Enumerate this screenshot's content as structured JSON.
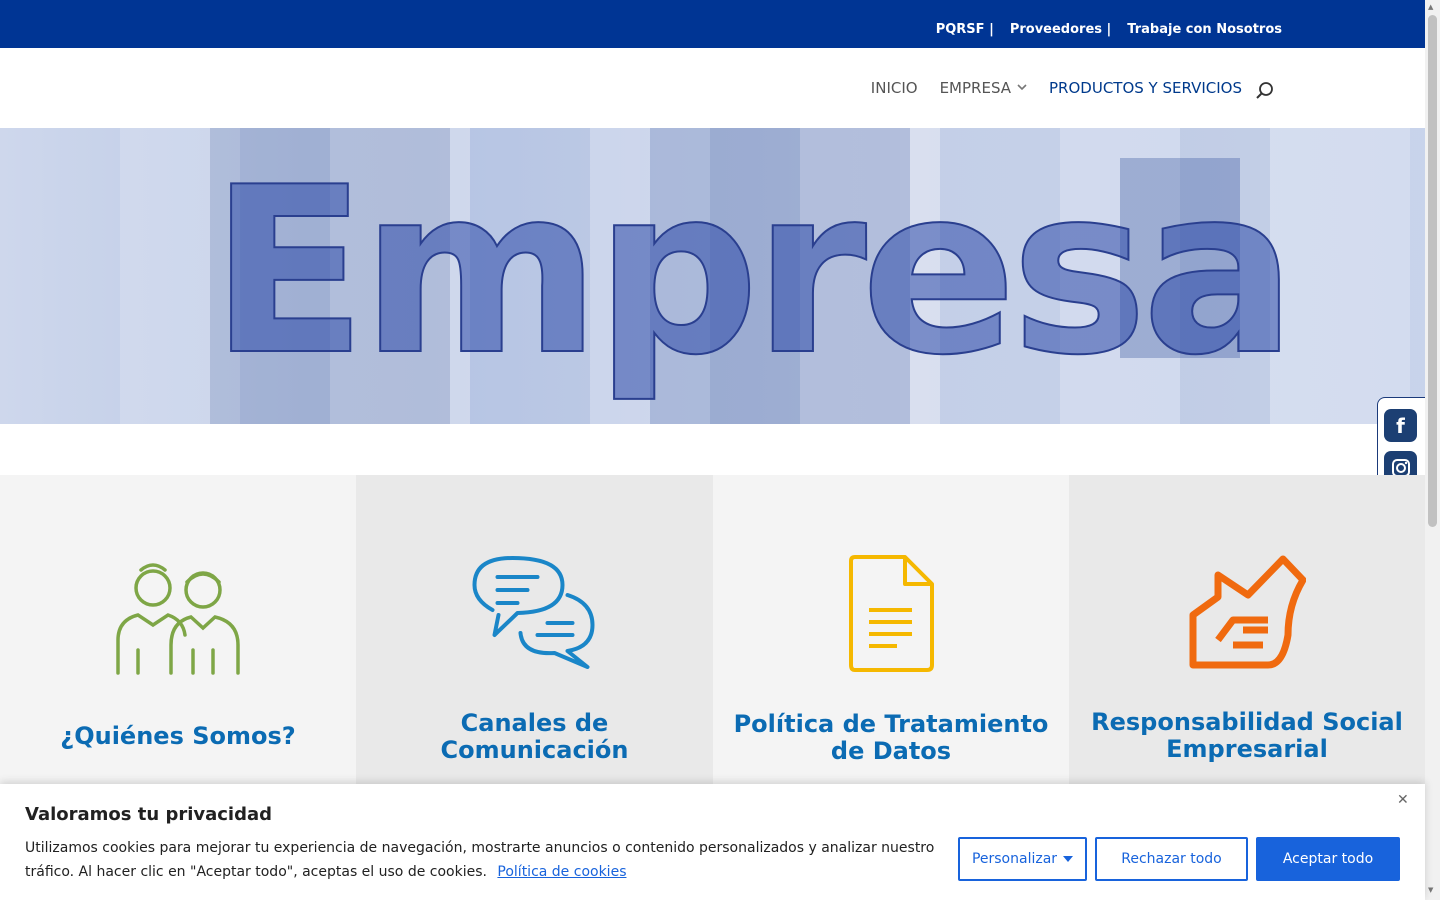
{
  "topbar": {
    "links": [
      "PQRSF |",
      "Proveedores |",
      "Trabaje con Nosotros"
    ]
  },
  "nav": {
    "items": [
      {
        "label": "INICIO"
      },
      {
        "label": "EMPRESA",
        "chevron": "3"
      },
      {
        "label": "PRODUCTOS Y SERVICIOS"
      }
    ],
    "search_icon": "search-icon"
  },
  "hero": {
    "title": "Empresa"
  },
  "social": {
    "items": [
      {
        "icon": "facebook-icon",
        "glyph": "f"
      },
      {
        "icon": "instagram-icon"
      }
    ]
  },
  "cards": [
    {
      "title": "¿Quiénes Somos?",
      "icon": "people-icon",
      "color": "#7ea646"
    },
    {
      "title": "Canales de Comunicación",
      "icon": "chat-bubbles-icon",
      "color": "#1a86c8"
    },
    {
      "title": "Política de Tratamiento de Datos",
      "icon": "document-icon",
      "color": "#f5b800"
    },
    {
      "title": "Responsabilidad Social Empresarial",
      "icon": "hand-house-icon",
      "color": "#f06a0f"
    }
  ],
  "cookie": {
    "title": "Valoramos tu privacidad",
    "text": "Utilizamos cookies para mejorar tu experiencia de navegación, mostrarte anuncios o contenido personalizados y analizar nuestro tráfico. Al hacer clic en \"Aceptar todo\", aceptas el uso de cookies.",
    "link": "Política de cookies",
    "customize": "Personalizar",
    "reject": "Rechazar todo",
    "accept": "Aceptar todo",
    "close": "✕"
  },
  "colors": {
    "topbar": "#003594",
    "accent": "#1863dc",
    "card_title": "#0b6bb3"
  }
}
